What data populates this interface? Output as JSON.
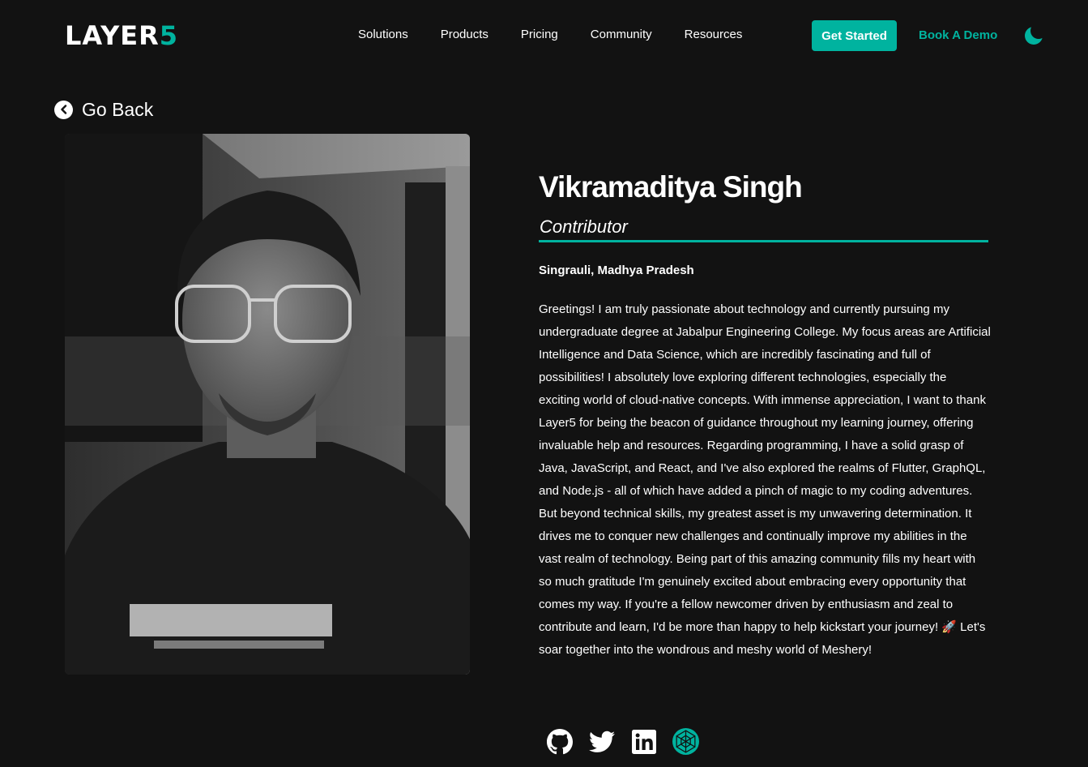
{
  "header": {
    "logo_main": "LAYER",
    "logo_accent": "5",
    "nav": [
      "Solutions",
      "Products",
      "Pricing",
      "Community",
      "Resources"
    ],
    "get_started": "Get Started",
    "book_demo": "Book A Demo",
    "theme_icon": "moon-icon"
  },
  "back": {
    "label": "Go Back",
    "icon": "chevron-left-icon"
  },
  "profile": {
    "name": "Vikramaditya Singh",
    "role": "Contributor",
    "location": "Singrauli, Madhya Pradesh",
    "bio": "Greetings! I am truly passionate about technology and currently pursuing my undergraduate degree at Jabalpur Engineering College. My focus areas are Artificial Intelligence and Data Science, which are incredibly fascinating and full of possibilities! I absolutely love exploring different technologies, especially the exciting world of cloud-native concepts. With immense appreciation, I want to thank Layer5 for being the beacon of guidance throughout my learning journey, offering invaluable help and resources. Regarding programming, I have a solid grasp of Java, JavaScript, and React, and I've also explored the realms of Flutter, GraphQL, and Node.js - all of which have added a pinch of magic to my coding adventures. But beyond technical skills, my greatest asset is my unwavering determination. It drives me to conquer new challenges and continually improve my abilities in the vast realm of technology. Being part of this amazing community fills my heart with so much gratitude I'm genuinely excited about embracing every opportunity that comes my way. If you're a fellow newcomer driven by enthusiasm and zeal to contribute and learn, I'd be more than happy to help kickstart your journey! 🚀 Let's soar together into the wondrous and meshy world of Meshery!",
    "socials": [
      "github-icon",
      "twitter-icon",
      "linkedin-icon",
      "meshery-icon"
    ]
  },
  "colors": {
    "accent": "#00b39f",
    "background": "#121212"
  }
}
